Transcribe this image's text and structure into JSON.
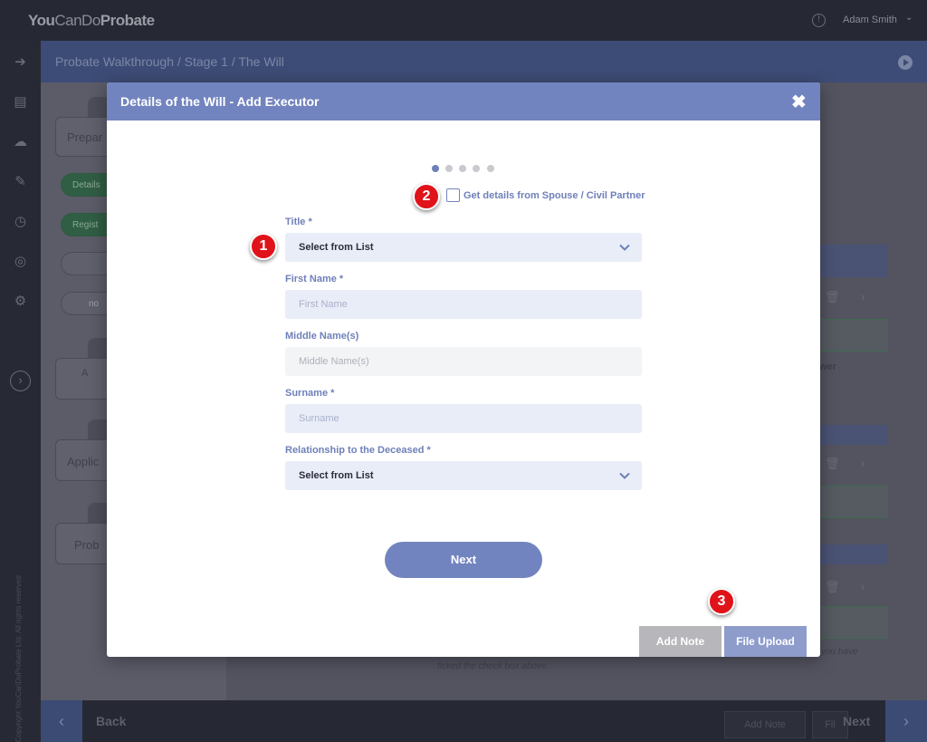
{
  "app": {
    "logo_you": "You",
    "logo_can": "Can",
    "logo_do": "Do",
    "logo_probate": "Probate",
    "user_name": "Adam Smith",
    "copyright": "© Copyright YouCanDoProbate Ltd. All rights reserved"
  },
  "breadcrumb": "Probate Walkthrough / Stage 1 / The Will",
  "background": {
    "card_prepare": "Prepar",
    "pill_details": "Details",
    "pill_regist": "Regist",
    "pill_no": "no",
    "card_text_a": "A",
    "card_text_applic": "Applic",
    "card_text_prob": "Prob",
    "snippet_wer": "wer",
    "snippet_you_have": "you have",
    "snippet_ticked": "ticked the check box above."
  },
  "modal": {
    "title": "Details of the Will - Add Executor",
    "close_glyph": "✖",
    "spouse_checkbox_label": "Get details from Spouse / Civil Partner",
    "fields": {
      "title_label": "Title *",
      "title_value": "Select from List",
      "first_name_label": "First Name *",
      "first_name_placeholder": "First Name",
      "middle_name_label": "Middle Name(s)",
      "middle_name_placeholder": "Middle Name(s)",
      "surname_label": "Surname *",
      "surname_placeholder": "Surname",
      "relationship_label": "Relationship to the Deceased *",
      "relationship_value": "Select from List"
    },
    "next_label": "Next",
    "add_note_label": "Add Note",
    "file_upload_label": "File Upload"
  },
  "markers": [
    "1",
    "2",
    "3"
  ],
  "footer": {
    "back_label": "Back",
    "add_note_label": "Add Note",
    "file_label": "Fil",
    "next_label": "Next"
  },
  "colors": {
    "accent": "#7284bf",
    "marker": "#e0131a",
    "field_bg": "#e9edf8"
  }
}
